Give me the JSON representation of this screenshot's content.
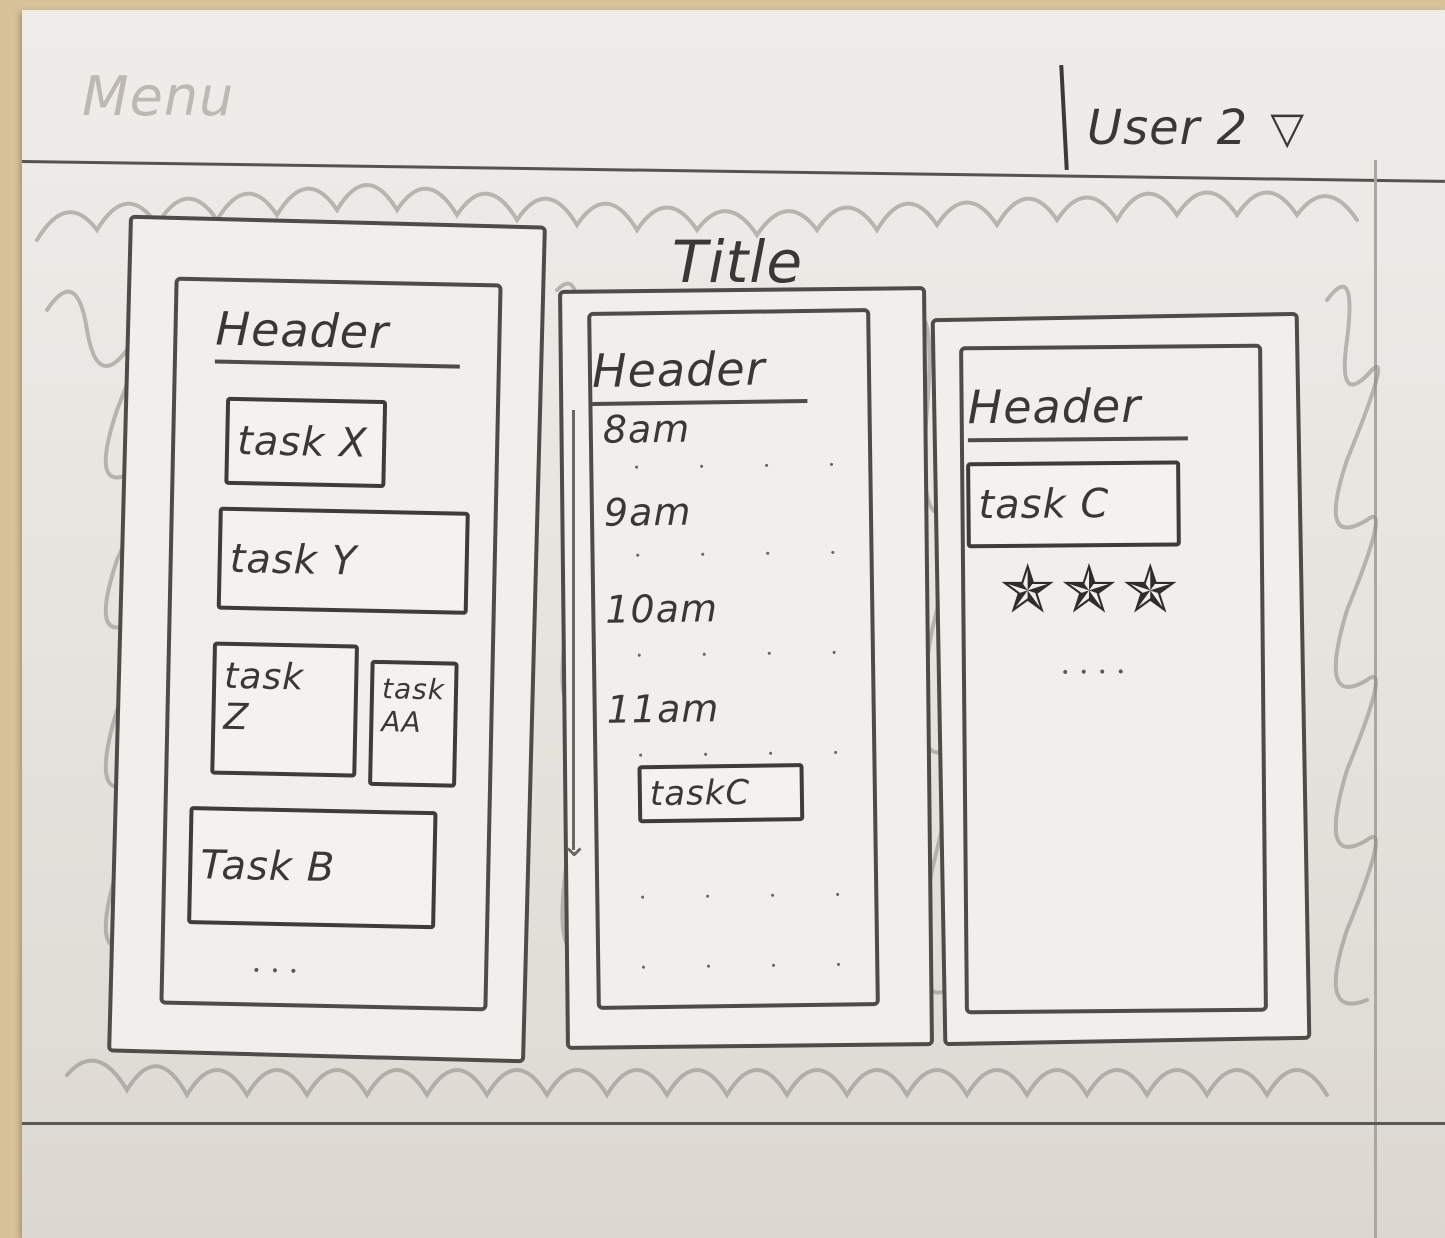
{
  "header": {
    "menu_label": "Menu",
    "user_label": "User 2",
    "user_chevron": "▽"
  },
  "board": {
    "title": "Title",
    "columns": [
      {
        "header": "Header",
        "tasks": [
          "task X",
          "task Y",
          "task Z",
          "task AA",
          "Task B"
        ],
        "more": "..."
      },
      {
        "header": "Header",
        "hours": [
          "8am",
          "9am",
          "10am",
          "11am"
        ],
        "task": "taskC",
        "dots": ". . . ."
      },
      {
        "header": "Header",
        "task": "task C",
        "rating": 3,
        "star_icon": "star-icon",
        "more": "...."
      }
    ]
  },
  "colors": {
    "pencil": "#4a4744",
    "paper": "#efedea",
    "desk": "#d8c29a"
  }
}
